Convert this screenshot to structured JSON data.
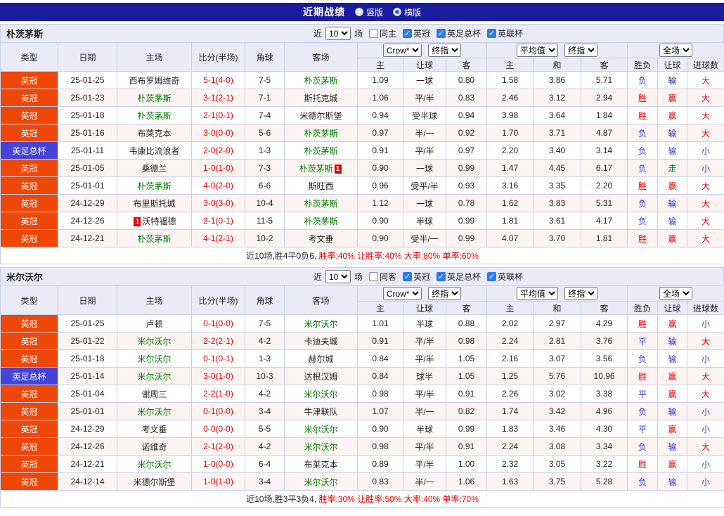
{
  "colors": {
    "topbar_bg": "#1b1b9e",
    "header_bg": "#eaebf7",
    "border": "#c9cfe8",
    "league_badge": "#ee4708",
    "cup_badge": "#4444d6",
    "team_highlight": "#007b00",
    "score_red": "#e60000",
    "result_red": "#e60000",
    "result_blue": "#3434c8",
    "result_green": "#008800",
    "summary_red": "#e60000"
  },
  "topbar": {
    "title": "近期战绩",
    "options": [
      {
        "label": "竖版",
        "selected": false
      },
      {
        "label": "横版",
        "selected": true
      }
    ]
  },
  "filters": {
    "near_label": "近",
    "count_value": "10",
    "games_label": "场",
    "leagues": [
      {
        "label": "英冠",
        "checked": true
      },
      {
        "label": "英足总杯",
        "checked": true
      },
      {
        "label": "英联杯",
        "checked": true
      }
    ]
  },
  "table_header": {
    "cols": [
      "类型",
      "日期",
      "主场",
      "比分(半场)",
      "角球",
      "客场"
    ],
    "group1": {
      "select1": "Crow*",
      "select2": "终指",
      "subcols": [
        "主",
        "让球",
        "客"
      ]
    },
    "group2": {
      "select1": "平均值",
      "select2": "终指",
      "subcols": [
        "主",
        "和",
        "客"
      ]
    },
    "group3": {
      "select1": "全场",
      "subcols": [
        "胜负",
        "让球",
        "进球数"
      ]
    }
  },
  "sections": [
    {
      "team": "朴茨茅斯",
      "same_filter": {
        "label": "同主",
        "checked": false
      },
      "rows": [
        {
          "league": "英冠",
          "date": "25-01-25",
          "home": {
            "name": "西布罗姆维奇"
          },
          "score": "5-1(4-0)",
          "corner": "7-5",
          "away": {
            "name": "朴茨茅斯",
            "is_team": true
          },
          "odds": [
            "1.09",
            "一球",
            "0.80",
            "1.58",
            "3.86",
            "5.71"
          ],
          "results": [
            "负",
            "输",
            "大"
          ]
        },
        {
          "league": "英冠",
          "date": "25-01-23",
          "home": {
            "name": "朴茨茅斯",
            "is_team": true
          },
          "score": "3-1(2-1)",
          "corner": "7-1",
          "away": {
            "name": "斯托克城"
          },
          "odds": [
            "1.06",
            "平/半",
            "0.83",
            "2.46",
            "3.12",
            "2.94"
          ],
          "results": [
            "胜",
            "赢",
            "大"
          ]
        },
        {
          "league": "英冠",
          "date": "25-01-18",
          "home": {
            "name": "朴茨茅斯",
            "is_team": true
          },
          "score": "2-1(0-1)",
          "corner": "7-4",
          "away": {
            "name": "米德尔斯堡"
          },
          "odds": [
            "0.94",
            "受半球",
            "0.94",
            "3.98",
            "3.64",
            "1.84"
          ],
          "results": [
            "胜",
            "赢",
            "大"
          ]
        },
        {
          "league": "英冠",
          "date": "25-01-16",
          "home": {
            "name": "布莱克本"
          },
          "score": "3-0(0-0)",
          "corner": "5-6",
          "away": {
            "name": "朴茨茅斯",
            "is_team": true
          },
          "odds": [
            "0.97",
            "半/一",
            "0.92",
            "1.70",
            "3.71",
            "4.87"
          ],
          "results": [
            "负",
            "输",
            "大"
          ]
        },
        {
          "league": "英足总杯",
          "date": "25-01-11",
          "home": {
            "name": "韦康比流浪者"
          },
          "score": "2-0(2-0)",
          "corner": "1-3",
          "away": {
            "name": "朴茨茅斯",
            "is_team": true
          },
          "odds": [
            "0.91",
            "平/半",
            "0.97",
            "2.20",
            "3.40",
            "3.14"
          ],
          "results": [
            "负",
            "输",
            "小"
          ]
        },
        {
          "league": "英冠",
          "date": "25-01-05",
          "home": {
            "name": "桑德兰"
          },
          "score": "1-0(1-0)",
          "corner": "7-3",
          "away": {
            "name": "朴茨茅斯",
            "is_team": true,
            "card_post": "1"
          },
          "odds": [
            "0.90",
            "一球",
            "0.99",
            "1.47",
            "4.45",
            "6.17"
          ],
          "results": [
            "负",
            "走",
            "小"
          ]
        },
        {
          "league": "英冠",
          "date": "25-01-01",
          "home": {
            "name": "朴茨茅斯",
            "is_team": true
          },
          "score": "4-0(2-0)",
          "corner": "6-6",
          "away": {
            "name": "斯旺西"
          },
          "odds": [
            "0.96",
            "受平/半",
            "0.93",
            "3.16",
            "3.35",
            "2.20"
          ],
          "results": [
            "胜",
            "赢",
            "大"
          ]
        },
        {
          "league": "英冠",
          "date": "24-12-29",
          "home": {
            "name": "布里斯托城"
          },
          "score": "3-0(3-0)",
          "corner": "10-4",
          "away": {
            "name": "朴茨茅斯",
            "is_team": true
          },
          "odds": [
            "1.12",
            "一球",
            "0.78",
            "1.62",
            "3.83",
            "5.31"
          ],
          "results": [
            "负",
            "输",
            "大"
          ]
        },
        {
          "league": "英冠",
          "date": "24-12-26",
          "home": {
            "name": "沃特福德",
            "card_pre": "1"
          },
          "score": "2-1(0-1)",
          "corner": "11-5",
          "away": {
            "name": "朴茨茅斯",
            "is_team": true
          },
          "odds": [
            "0.90",
            "半球",
            "0.99",
            "1.81",
            "3.61",
            "4.17"
          ],
          "results": [
            "负",
            "输",
            "大"
          ]
        },
        {
          "league": "英冠",
          "date": "24-12-21",
          "home": {
            "name": "朴茨茅斯",
            "is_team": true
          },
          "score": "4-1(2-1)",
          "corner": "10-2",
          "away": {
            "name": "考文垂"
          },
          "odds": [
            "0.90",
            "受半/一",
            "0.99",
            "4.07",
            "3.70",
            "1.81"
          ],
          "results": [
            "胜",
            "赢",
            "大"
          ]
        }
      ],
      "summary_prefix": "近10场,胜4平0负6,",
      "summary_stats": " 胜率:40% 让胜率:40% 大率:80% 单率:60%"
    },
    {
      "team": "米尔沃尔",
      "same_filter": {
        "label": "同客",
        "checked": false
      },
      "rows": [
        {
          "league": "英冠",
          "date": "25-01-25",
          "home": {
            "name": "卢顿"
          },
          "score": "0-1(0-0)",
          "corner": "7-5",
          "away": {
            "name": "米尔沃尔",
            "is_team": true
          },
          "odds": [
            "1.01",
            "半球",
            "0.88",
            "2.02",
            "2.97",
            "4.29"
          ],
          "results": [
            "胜",
            "赢",
            "小"
          ]
        },
        {
          "league": "英冠",
          "date": "25-01-22",
          "home": {
            "name": "米尔沃尔",
            "is_team": true
          },
          "score": "2-2(2-1)",
          "corner": "4-2",
          "away": {
            "name": "卡迪夫城"
          },
          "odds": [
            "0.91",
            "平/半",
            "0.98",
            "2.24",
            "2.81",
            "3.76"
          ],
          "results": [
            "平",
            "输",
            "大"
          ]
        },
        {
          "league": "英冠",
          "date": "25-01-18",
          "home": {
            "name": "米尔沃尔",
            "is_team": true
          },
          "score": "0-1(0-1)",
          "corner": "1-3",
          "away": {
            "name": "赫尔城"
          },
          "odds": [
            "0.84",
            "平/半",
            "1.05",
            "2.16",
            "3.07",
            "3.56"
          ],
          "results": [
            "负",
            "输",
            "小"
          ]
        },
        {
          "league": "英足总杯",
          "date": "25-01-14",
          "home": {
            "name": "米尔沃尔",
            "is_team": true
          },
          "score": "3-0(1-0)",
          "corner": "10-3",
          "away": {
            "name": "达根汉姆"
          },
          "odds": [
            "0.84",
            "球半",
            "1.05",
            "1.25",
            "5.76",
            "10.96"
          ],
          "results": [
            "胜",
            "赢",
            "大"
          ]
        },
        {
          "league": "英冠",
          "date": "25-01-04",
          "home": {
            "name": "谢周三"
          },
          "score": "2-2(1-0)",
          "corner": "4-2",
          "away": {
            "name": "米尔沃尔",
            "is_team": true
          },
          "odds": [
            "0.98",
            "平/半",
            "0.91",
            "2.26",
            "3.02",
            "3.38"
          ],
          "results": [
            "平",
            "赢",
            "大"
          ]
        },
        {
          "league": "英冠",
          "date": "25-01-01",
          "home": {
            "name": "米尔沃尔",
            "is_team": true
          },
          "score": "0-1(0-0)",
          "corner": "3-4",
          "away": {
            "name": "牛津联队"
          },
          "odds": [
            "1.07",
            "半/一",
            "0.82",
            "1.74",
            "3.42",
            "4.96"
          ],
          "results": [
            "负",
            "输",
            "小"
          ]
        },
        {
          "league": "英冠",
          "date": "24-12-29",
          "home": {
            "name": "考文垂"
          },
          "score": "0-0(0-0)",
          "corner": "5-5",
          "away": {
            "name": "米尔沃尔",
            "is_team": true
          },
          "odds": [
            "0.90",
            "半球",
            "0.99",
            "1.83",
            "3.46",
            "4.30"
          ],
          "results": [
            "平",
            "赢",
            "小"
          ]
        },
        {
          "league": "英冠",
          "date": "24-12-26",
          "home": {
            "name": "诺维奇"
          },
          "score": "2-1(2-0)",
          "corner": "4-2",
          "away": {
            "name": "米尔沃尔",
            "is_team": true
          },
          "odds": [
            "0.98",
            "平/半",
            "0.91",
            "2.24",
            "3.08",
            "3.34"
          ],
          "results": [
            "负",
            "输",
            "大"
          ]
        },
        {
          "league": "英冠",
          "date": "24-12-21",
          "home": {
            "name": "米尔沃尔",
            "is_team": true
          },
          "score": "1-0(0-0)",
          "corner": "6-4",
          "away": {
            "name": "布莱克本"
          },
          "odds": [
            "0.89",
            "平/半",
            "1.00",
            "2.32",
            "3.05",
            "3.22"
          ],
          "results": [
            "胜",
            "赢",
            "小"
          ]
        },
        {
          "league": "英冠",
          "date": "24-12-14",
          "home": {
            "name": "米德尔斯堡"
          },
          "score": "1-0(1-0)",
          "corner": "3-4",
          "away": {
            "name": "米尔沃尔",
            "is_team": true
          },
          "odds": [
            "0.83",
            "半/一",
            "1.06",
            "1.63",
            "3.75",
            "5.28"
          ],
          "results": [
            "负",
            "输",
            "小"
          ]
        }
      ],
      "summary_prefix": "近10场,胜3平3负4,",
      "summary_stats": " 胜率:30% 让胜率:50% 大率:40% 单率:70%"
    }
  ]
}
